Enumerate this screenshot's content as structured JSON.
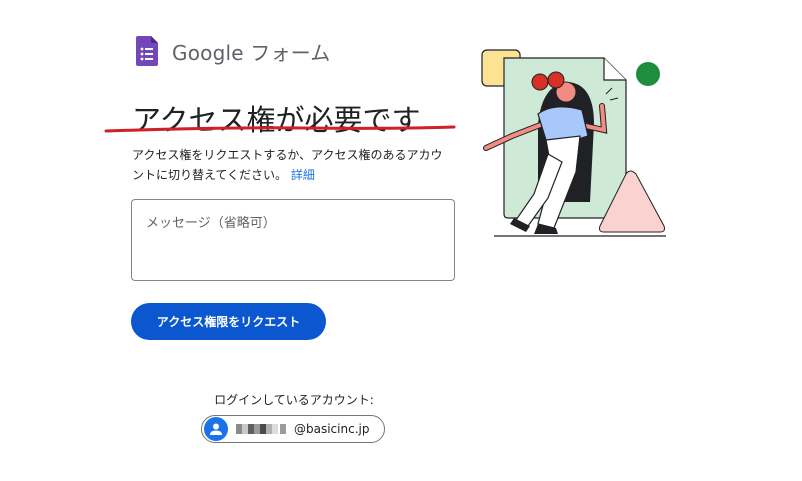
{
  "brand": {
    "logo_text": "Google フォーム",
    "icon": "google-forms-icon",
    "color": "#7248b9"
  },
  "main": {
    "title": "アクセス権が必要です",
    "description": "アクセス権をリクエストするか、アクセス権のあるアカウントに切り替えてください。",
    "details_link": "詳細",
    "message_placeholder": "メッセージ（省略可）",
    "request_button": "アクセス権限をリクエスト"
  },
  "account": {
    "label": "ログインしているアカウント:",
    "email_domain": "@basicinc.jp",
    "avatar_icon": "user-avatar-icon"
  },
  "colors": {
    "accent": "#0b57d0",
    "link": "#1a73e8",
    "annotation_underline": "#d0202a"
  }
}
